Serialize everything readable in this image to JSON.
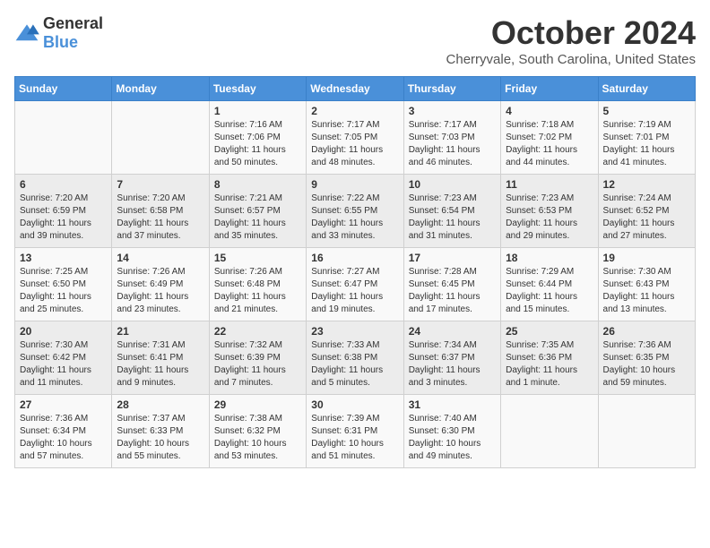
{
  "logo": {
    "general": "General",
    "blue": "Blue"
  },
  "title": "October 2024",
  "location": "Cherryvale, South Carolina, United States",
  "days_of_week": [
    "Sunday",
    "Monday",
    "Tuesday",
    "Wednesday",
    "Thursday",
    "Friday",
    "Saturday"
  ],
  "weeks": [
    [
      {
        "day": "",
        "content": ""
      },
      {
        "day": "",
        "content": ""
      },
      {
        "day": "1",
        "content": "Sunrise: 7:16 AM\nSunset: 7:06 PM\nDaylight: 11 hours and 50 minutes."
      },
      {
        "day": "2",
        "content": "Sunrise: 7:17 AM\nSunset: 7:05 PM\nDaylight: 11 hours and 48 minutes."
      },
      {
        "day": "3",
        "content": "Sunrise: 7:17 AM\nSunset: 7:03 PM\nDaylight: 11 hours and 46 minutes."
      },
      {
        "day": "4",
        "content": "Sunrise: 7:18 AM\nSunset: 7:02 PM\nDaylight: 11 hours and 44 minutes."
      },
      {
        "day": "5",
        "content": "Sunrise: 7:19 AM\nSunset: 7:01 PM\nDaylight: 11 hours and 41 minutes."
      }
    ],
    [
      {
        "day": "6",
        "content": "Sunrise: 7:20 AM\nSunset: 6:59 PM\nDaylight: 11 hours and 39 minutes."
      },
      {
        "day": "7",
        "content": "Sunrise: 7:20 AM\nSunset: 6:58 PM\nDaylight: 11 hours and 37 minutes."
      },
      {
        "day": "8",
        "content": "Sunrise: 7:21 AM\nSunset: 6:57 PM\nDaylight: 11 hours and 35 minutes."
      },
      {
        "day": "9",
        "content": "Sunrise: 7:22 AM\nSunset: 6:55 PM\nDaylight: 11 hours and 33 minutes."
      },
      {
        "day": "10",
        "content": "Sunrise: 7:23 AM\nSunset: 6:54 PM\nDaylight: 11 hours and 31 minutes."
      },
      {
        "day": "11",
        "content": "Sunrise: 7:23 AM\nSunset: 6:53 PM\nDaylight: 11 hours and 29 minutes."
      },
      {
        "day": "12",
        "content": "Sunrise: 7:24 AM\nSunset: 6:52 PM\nDaylight: 11 hours and 27 minutes."
      }
    ],
    [
      {
        "day": "13",
        "content": "Sunrise: 7:25 AM\nSunset: 6:50 PM\nDaylight: 11 hours and 25 minutes."
      },
      {
        "day": "14",
        "content": "Sunrise: 7:26 AM\nSunset: 6:49 PM\nDaylight: 11 hours and 23 minutes."
      },
      {
        "day": "15",
        "content": "Sunrise: 7:26 AM\nSunset: 6:48 PM\nDaylight: 11 hours and 21 minutes."
      },
      {
        "day": "16",
        "content": "Sunrise: 7:27 AM\nSunset: 6:47 PM\nDaylight: 11 hours and 19 minutes."
      },
      {
        "day": "17",
        "content": "Sunrise: 7:28 AM\nSunset: 6:45 PM\nDaylight: 11 hours and 17 minutes."
      },
      {
        "day": "18",
        "content": "Sunrise: 7:29 AM\nSunset: 6:44 PM\nDaylight: 11 hours and 15 minutes."
      },
      {
        "day": "19",
        "content": "Sunrise: 7:30 AM\nSunset: 6:43 PM\nDaylight: 11 hours and 13 minutes."
      }
    ],
    [
      {
        "day": "20",
        "content": "Sunrise: 7:30 AM\nSunset: 6:42 PM\nDaylight: 11 hours and 11 minutes."
      },
      {
        "day": "21",
        "content": "Sunrise: 7:31 AM\nSunset: 6:41 PM\nDaylight: 11 hours and 9 minutes."
      },
      {
        "day": "22",
        "content": "Sunrise: 7:32 AM\nSunset: 6:39 PM\nDaylight: 11 hours and 7 minutes."
      },
      {
        "day": "23",
        "content": "Sunrise: 7:33 AM\nSunset: 6:38 PM\nDaylight: 11 hours and 5 minutes."
      },
      {
        "day": "24",
        "content": "Sunrise: 7:34 AM\nSunset: 6:37 PM\nDaylight: 11 hours and 3 minutes."
      },
      {
        "day": "25",
        "content": "Sunrise: 7:35 AM\nSunset: 6:36 PM\nDaylight: 11 hours and 1 minute."
      },
      {
        "day": "26",
        "content": "Sunrise: 7:36 AM\nSunset: 6:35 PM\nDaylight: 10 hours and 59 minutes."
      }
    ],
    [
      {
        "day": "27",
        "content": "Sunrise: 7:36 AM\nSunset: 6:34 PM\nDaylight: 10 hours and 57 minutes."
      },
      {
        "day": "28",
        "content": "Sunrise: 7:37 AM\nSunset: 6:33 PM\nDaylight: 10 hours and 55 minutes."
      },
      {
        "day": "29",
        "content": "Sunrise: 7:38 AM\nSunset: 6:32 PM\nDaylight: 10 hours and 53 minutes."
      },
      {
        "day": "30",
        "content": "Sunrise: 7:39 AM\nSunset: 6:31 PM\nDaylight: 10 hours and 51 minutes."
      },
      {
        "day": "31",
        "content": "Sunrise: 7:40 AM\nSunset: 6:30 PM\nDaylight: 10 hours and 49 minutes."
      },
      {
        "day": "",
        "content": ""
      },
      {
        "day": "",
        "content": ""
      }
    ]
  ]
}
